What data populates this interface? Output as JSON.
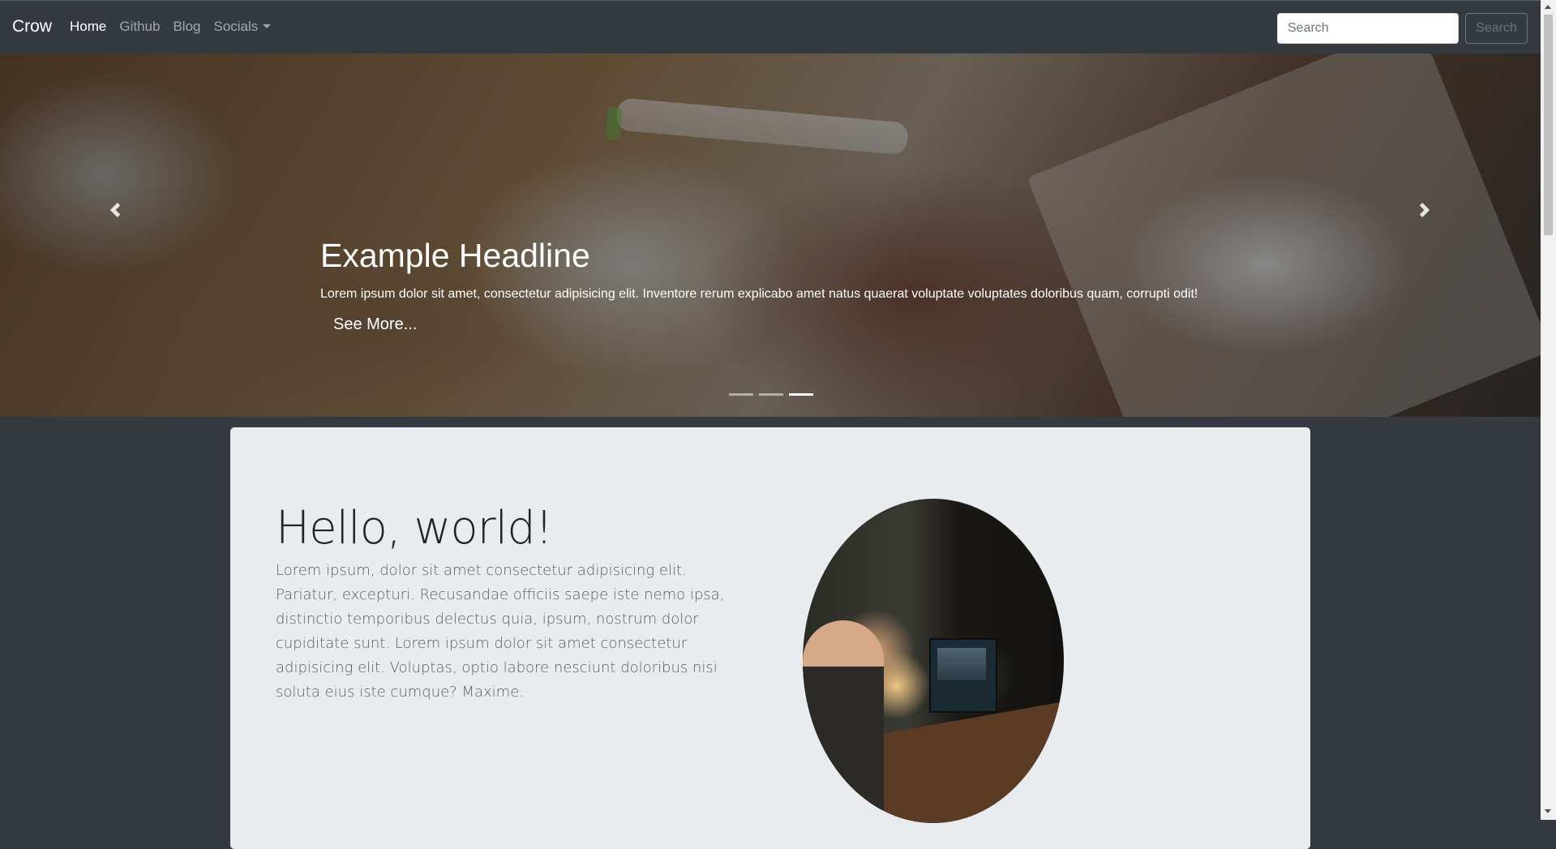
{
  "navbar": {
    "brand": "Crow",
    "links": [
      {
        "label": "Home",
        "active": true
      },
      {
        "label": "Github",
        "active": false
      },
      {
        "label": "Blog",
        "active": false
      },
      {
        "label": "Socials",
        "active": false,
        "dropdown": true
      }
    ],
    "search": {
      "placeholder": "Search",
      "button_label": "Search"
    }
  },
  "carousel": {
    "headline": "Example Headline",
    "text": "Lorem ipsum dolor sit amet, consectetur adipisicing elit. Inventore rerum explicabo amet natus quaerat voluptate voluptates doloribus quam, corrupti odit!",
    "cta_label": "See More...",
    "slide_count": 3,
    "active_slide": 3,
    "prev_icon": "chevron-left-icon",
    "next_icon": "chevron-right-icon"
  },
  "jumbotron": {
    "title": "Hello, world!",
    "text": "Lorem ipsum, dolor sit amet consectetur adipisicing elit. Pariatur, excepturi. Recusandae officiis saepe iste nemo ipsa, distinctio temporibus delectus quia, ipsum, nostrum dolor cupiditate sunt. Lorem ipsum dolor sit amet consectetur adipisicing elit. Voluptas, optio labore nesciunt doloribus nisi soluta eius iste cumque? Maxime."
  },
  "colors": {
    "navbar_bg": "#343a40",
    "jumbotron_bg": "#e9ecef",
    "page_bg": "#343a40"
  }
}
